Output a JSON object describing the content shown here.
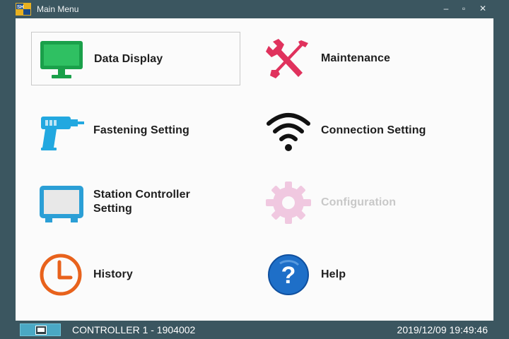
{
  "window": {
    "title": "Main Menu",
    "controls": {
      "minimize": "‒",
      "maximize": "▫",
      "close": "✕"
    }
  },
  "menu": {
    "items": [
      {
        "label": "Data Display",
        "icon": "monitor-icon",
        "color": "#1aa04a",
        "selected": true,
        "enabled": true
      },
      {
        "label": "Maintenance",
        "icon": "tools-icon",
        "color": "#e0325d",
        "selected": false,
        "enabled": true
      },
      {
        "label": "Fastening Setting",
        "icon": "drill-icon",
        "color": "#22a8e0",
        "selected": false,
        "enabled": true
      },
      {
        "label": "Connection Setting",
        "icon": "wifi-icon",
        "color": "#111111",
        "selected": false,
        "enabled": true
      },
      {
        "label": "Station Controller Setting",
        "icon": "tablet-icon",
        "color": "#2b9fd6",
        "selected": false,
        "enabled": true
      },
      {
        "label": "Configuration",
        "icon": "gear-icon",
        "color": "#f0c8e0",
        "selected": false,
        "enabled": false
      },
      {
        "label": "History",
        "icon": "clock-icon",
        "color": "#e8621c",
        "selected": false,
        "enabled": true
      },
      {
        "label": "Help",
        "icon": "help-icon",
        "color": "#1e6fc8",
        "selected": false,
        "enabled": true
      }
    ]
  },
  "status": {
    "controller": "CONTROLLER 1 - 1904002",
    "datetime": "2019/12/09 19:49:46"
  }
}
